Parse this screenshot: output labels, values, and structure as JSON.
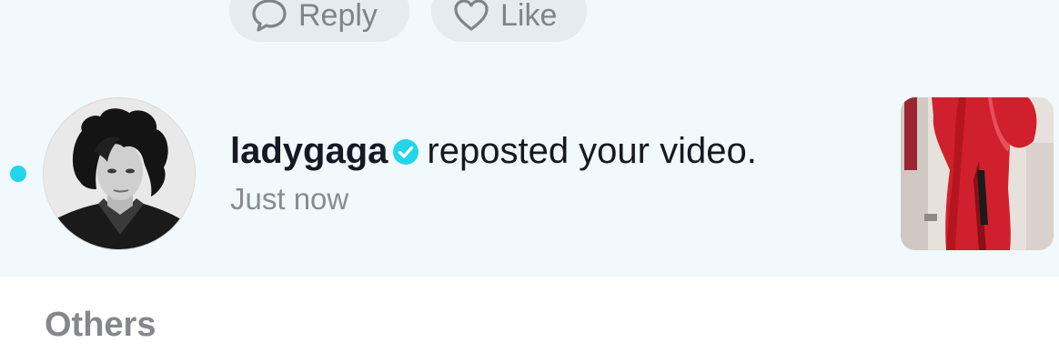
{
  "actions": {
    "reply_label": "Reply",
    "like_label": "Like"
  },
  "notification": {
    "username": "ladygaga",
    "message": "reposted your video.",
    "timestamp": "Just now",
    "unread": true,
    "verified": true
  },
  "section": {
    "title": "Others"
  },
  "colors": {
    "unread_dot": "#20d5ec",
    "verified_badge": "#20d5ec",
    "notification_background": "#f1f9fc",
    "button_background": "#e4ecef",
    "thumbnail_dress": "#d1202d"
  },
  "icons": {
    "reply": "speech-bubble-icon",
    "like": "heart-outline-icon",
    "verified": "checkmark-badge-icon"
  }
}
